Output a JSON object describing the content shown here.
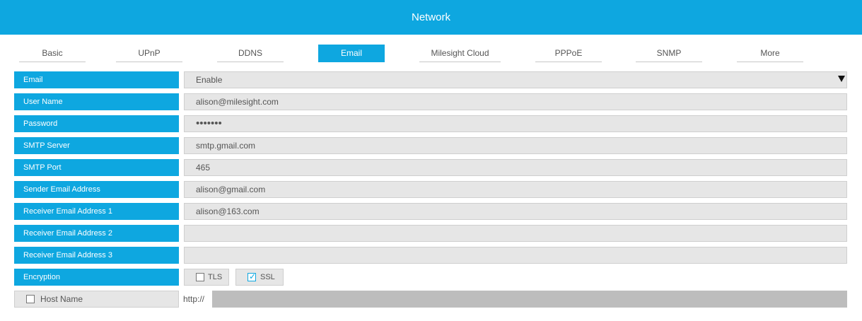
{
  "header": {
    "title": "Network"
  },
  "tabs": [
    {
      "label": "Basic"
    },
    {
      "label": "UPnP"
    },
    {
      "label": "DDNS"
    },
    {
      "label": "Email"
    },
    {
      "label": "Milesight Cloud"
    },
    {
      "label": "PPPoE"
    },
    {
      "label": "SNMP"
    },
    {
      "label": "More"
    }
  ],
  "active_tab": "Email",
  "form": {
    "email": {
      "label": "Email",
      "value": "Enable"
    },
    "user_name": {
      "label": "User Name",
      "value": "alison@milesight.com"
    },
    "password": {
      "label": "Password",
      "value": "•••••••"
    },
    "smtp_server": {
      "label": "SMTP Server",
      "value": "smtp.gmail.com"
    },
    "smtp_port": {
      "label": "SMTP Port",
      "value": "465"
    },
    "sender": {
      "label": "Sender Email Address",
      "value": "alison@gmail.com"
    },
    "receiver1": {
      "label": "Receiver Email Address 1",
      "value": "alison@163.com"
    },
    "receiver2": {
      "label": "Receiver Email Address 2",
      "value": ""
    },
    "receiver3": {
      "label": "Receiver Email Address 3",
      "value": ""
    },
    "encryption": {
      "label": "Encryption",
      "tls": {
        "label": "TLS",
        "checked": false
      },
      "ssl": {
        "label": "SSL",
        "checked": true
      }
    },
    "host_name": {
      "label": "Host Name",
      "checked": false,
      "prefix": "http://",
      "value": ""
    }
  },
  "colors": {
    "accent": "#0ea7e0",
    "field_bg": "#e6e6e6",
    "disabled_bg": "#bdbdbd"
  },
  "icons": {
    "dropdown": "caret-down-icon",
    "check": "checkmark-icon"
  }
}
